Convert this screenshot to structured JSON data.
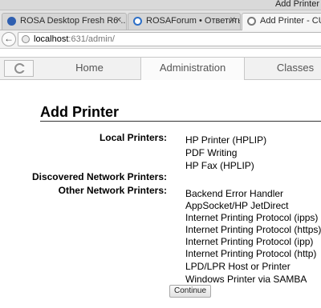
{
  "window": {
    "title": "Add Printer"
  },
  "tabs": [
    {
      "label": "ROSA Desktop Fresh R6 ...",
      "icon": "rosa-icon",
      "active": false
    },
    {
      "label": "ROSAForum • Ответить",
      "icon": "forum-icon",
      "active": false
    },
    {
      "label": "Add Printer - CUPS",
      "icon": "cups-icon",
      "active": true
    }
  ],
  "address": {
    "host": "localhost",
    "rest": ":631/admin/"
  },
  "cups_nav": {
    "items": [
      "Home",
      "Administration",
      "Classes"
    ],
    "active": "Administration"
  },
  "page": {
    "heading": "Add Printer",
    "local_label": "Local Printers:",
    "local_options": [
      "HP Printer (HPLIP)",
      "PDF Writing",
      "HP Fax (HPLIP)"
    ],
    "discovered_label": "Discovered Network Printers:",
    "other_label": "Other Network Printers:",
    "other_options": [
      "Backend Error Handler",
      "AppSocket/HP JetDirect",
      "Internet Printing Protocol (ipps)",
      "Internet Printing Protocol (https)",
      "Internet Printing Protocol (ipp)",
      "Internet Printing Protocol (http)",
      "LPD/LPR Host or Printer",
      "Windows Printer via SAMBA"
    ],
    "continue_label": "Continue"
  }
}
